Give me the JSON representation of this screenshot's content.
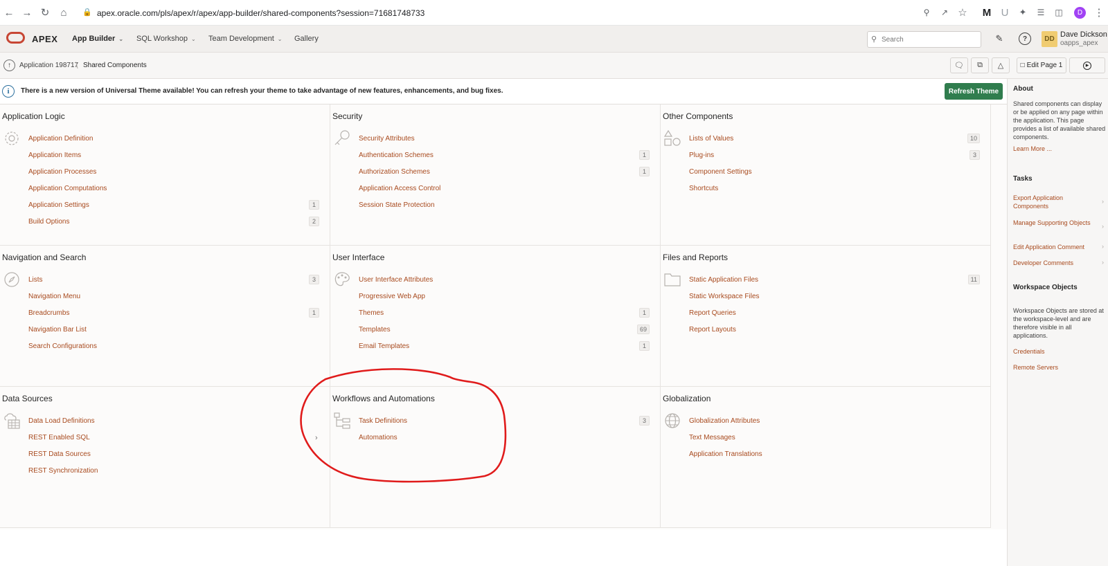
{
  "browser": {
    "url": "apex.oracle.com/pls/apex/r/apex/app-builder/shared-components?session=71681748733",
    "profile_initial": "D"
  },
  "header": {
    "brand": "APEX",
    "nav": [
      {
        "label": "App Builder"
      },
      {
        "label": "SQL Workshop"
      },
      {
        "label": "Team Development"
      },
      {
        "label": "Gallery"
      }
    ],
    "search_placeholder": "Search",
    "avatar_initials": "DD",
    "user_name": "Dave Dickson",
    "workspace": "oapps_apex"
  },
  "breadcrumb": {
    "app": "Application 198717",
    "current": "Shared Components",
    "edit_page_label": "Edit Page 1"
  },
  "alert": {
    "text": "There is a new version of Universal Theme available! You can refresh your theme to take advantage of new features, enhancements, and bug fixes.",
    "button": "Refresh Theme"
  },
  "cards": [
    {
      "title": "Application Logic",
      "icon": "gear-icon",
      "items": [
        {
          "label": "Application Definition",
          "count": ""
        },
        {
          "label": "Application Items",
          "count": ""
        },
        {
          "label": "Application Processes",
          "count": ""
        },
        {
          "label": "Application Computations",
          "count": ""
        },
        {
          "label": "Application Settings",
          "count": "1"
        },
        {
          "label": "Build Options",
          "count": "2"
        }
      ]
    },
    {
      "title": "Security",
      "icon": "key-icon",
      "items": [
        {
          "label": "Security Attributes",
          "count": ""
        },
        {
          "label": "Authentication Schemes",
          "count": "1"
        },
        {
          "label": "Authorization Schemes",
          "count": "1"
        },
        {
          "label": "Application Access Control",
          "count": ""
        },
        {
          "label": "Session State Protection",
          "count": ""
        }
      ]
    },
    {
      "title": "Other Components",
      "icon": "shapes-icon",
      "items": [
        {
          "label": "Lists of Values",
          "count": "10"
        },
        {
          "label": "Plug-ins",
          "count": "3"
        },
        {
          "label": "Component Settings",
          "count": ""
        },
        {
          "label": "Shortcuts",
          "count": ""
        }
      ]
    },
    {
      "title": "Navigation and Search",
      "icon": "compass-icon",
      "items": [
        {
          "label": "Lists",
          "count": "3"
        },
        {
          "label": "Navigation Menu",
          "count": ""
        },
        {
          "label": "Breadcrumbs",
          "count": "1"
        },
        {
          "label": "Navigation Bar List",
          "count": ""
        },
        {
          "label": "Search Configurations",
          "count": ""
        }
      ]
    },
    {
      "title": "User Interface",
      "icon": "palette-icon",
      "items": [
        {
          "label": "User Interface Attributes",
          "count": ""
        },
        {
          "label": "Progressive Web App",
          "count": ""
        },
        {
          "label": "Themes",
          "count": "1"
        },
        {
          "label": "Templates",
          "count": "69"
        },
        {
          "label": "Email Templates",
          "count": "1"
        }
      ]
    },
    {
      "title": "Files and Reports",
      "icon": "folder-icon",
      "items": [
        {
          "label": "Static Application Files",
          "count": "11"
        },
        {
          "label": "Static Workspace Files",
          "count": ""
        },
        {
          "label": "Report Queries",
          "count": ""
        },
        {
          "label": "Report Layouts",
          "count": ""
        }
      ]
    },
    {
      "title": "Data Sources",
      "icon": "cloud-table-icon",
      "items": [
        {
          "label": "Data Load Definitions",
          "count": ""
        },
        {
          "label": "REST Enabled SQL",
          "count": ""
        },
        {
          "label": "REST Data Sources",
          "count": ""
        },
        {
          "label": "REST Synchronization",
          "count": ""
        }
      ]
    },
    {
      "title": "Workflows and Automations",
      "icon": "tree-icon",
      "items": [
        {
          "label": "Task Definitions",
          "count": "3"
        },
        {
          "label": "Automations",
          "count": ""
        }
      ]
    },
    {
      "title": "Globalization",
      "icon": "globe-icon",
      "items": [
        {
          "label": "Globalization Attributes",
          "count": ""
        },
        {
          "label": "Text Messages",
          "count": ""
        },
        {
          "label": "Application Translations",
          "count": ""
        }
      ]
    }
  ],
  "sidebar": {
    "about_title": "About",
    "about_text": "Shared components can display or be applied on any page within the application. This page provides a list of available shared components.",
    "learn_more": "Learn More ...",
    "tasks_title": "Tasks",
    "tasks": [
      {
        "label": "Export Application Components"
      },
      {
        "label": "Manage Supporting Objects"
      },
      {
        "label": "Edit Application Comment"
      },
      {
        "label": "Developer Comments"
      }
    ],
    "workspace_title": "Workspace Objects",
    "workspace_text": "Workspace Objects are stored at the workspace-level and are therefore visible in all applications.",
    "workspace_links": [
      {
        "label": "Credentials"
      },
      {
        "label": "Remote Servers"
      }
    ]
  },
  "colors": {
    "link": "#a84a1e",
    "accent_green": "#307d4e",
    "annotation": "#e01b1b"
  }
}
